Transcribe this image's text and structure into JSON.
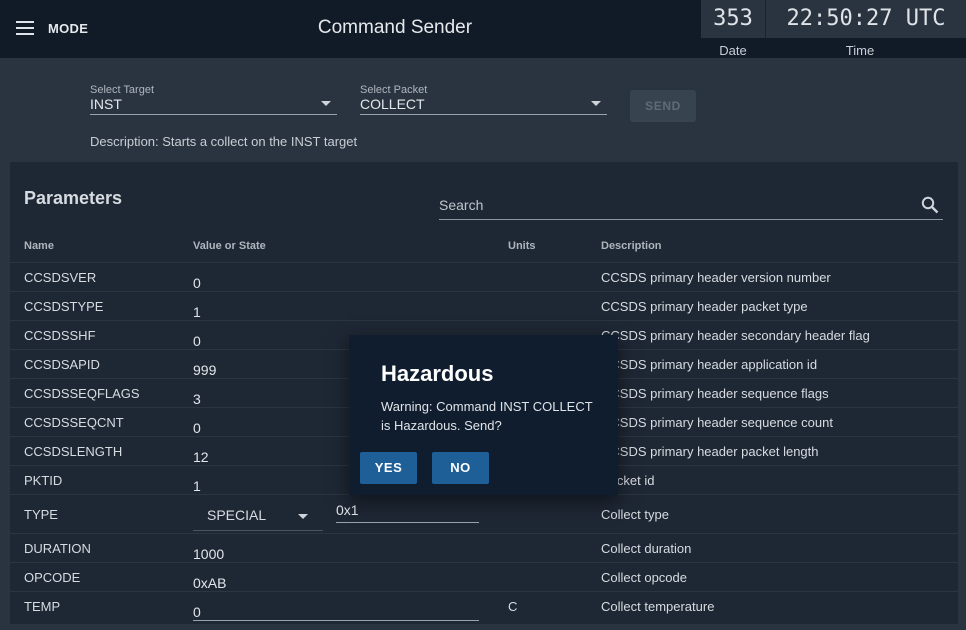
{
  "appbar": {
    "mode_label": "MODE",
    "title": "Command Sender"
  },
  "clock": {
    "day": "353",
    "time": "22:50:27 UTC",
    "date_label": "Date",
    "time_label": "Time"
  },
  "target": {
    "label": "Select Target",
    "value": "INST"
  },
  "packet": {
    "label": "Select Packet",
    "value": "COLLECT"
  },
  "send_label": "SEND",
  "description": "Description: Starts a collect on the INST target",
  "parameters": {
    "title": "Parameters",
    "search_placeholder": "Search",
    "headers": {
      "name": "Name",
      "value": "Value or State",
      "units": "Units",
      "description": "Description"
    },
    "rows": [
      {
        "name": "CCSDSVER",
        "value": "0",
        "units": "",
        "description": "CCSDS primary header version number"
      },
      {
        "name": "CCSDSTYPE",
        "value": "1",
        "units": "",
        "description": "CCSDS primary header packet type"
      },
      {
        "name": "CCSDSSHF",
        "value": "0",
        "units": "",
        "description": "CCSDS primary header secondary header flag"
      },
      {
        "name": "CCSDSAPID",
        "value": "999",
        "units": "",
        "description": "CCSDS primary header application id"
      },
      {
        "name": "CCSDSSEQFLAGS",
        "value": "3",
        "units": "",
        "description": "CCSDS primary header sequence flags"
      },
      {
        "name": "CCSDSSEQCNT",
        "value": "0",
        "units": "",
        "description": "CCSDS primary header sequence count"
      },
      {
        "name": "CCSDSLENGTH",
        "value": "12",
        "units": "",
        "description": "CCSDS primary header packet length"
      },
      {
        "name": "PKTID",
        "value": "1",
        "units": "",
        "description": "Packet id"
      },
      {
        "name": "TYPE",
        "state": "SPECIAL",
        "value": "0x1",
        "units": "",
        "description": "Collect type"
      },
      {
        "name": "DURATION",
        "value": "1000",
        "units": "",
        "description": "Collect duration"
      },
      {
        "name": "OPCODE",
        "value": "0xAB",
        "units": "",
        "description": "Collect opcode"
      },
      {
        "name": "TEMP",
        "value": "0",
        "units": "C",
        "description": "Collect temperature"
      }
    ]
  },
  "dialog": {
    "title": "Hazardous",
    "message": "Warning: Command INST COLLECT is Hazardous. Send?",
    "yes_label": "YES",
    "no_label": "NO"
  }
}
